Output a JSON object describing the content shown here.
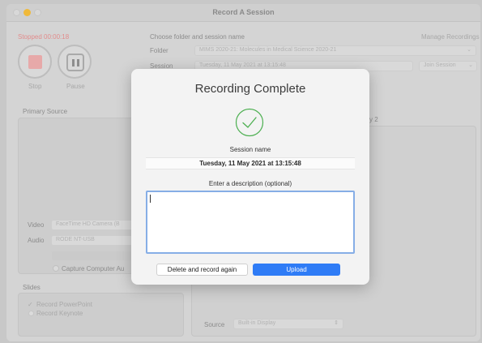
{
  "window": {
    "title": "Record A Session"
  },
  "recorder": {
    "status": "Stopped 00:00:18",
    "stop_label": "Stop",
    "pause_label": "Pause"
  },
  "session_setup": {
    "heading": "Choose folder and session name",
    "manage_link": "Manage Recordings",
    "folder_label": "Folder",
    "folder_value": "MIMS 2020-21: Molecules in Medical Science 2020-21",
    "session_label": "Session",
    "session_value": "Tuesday, 11 May 2021 at 13:15:48",
    "join_session": "Join Session"
  },
  "primary_source": {
    "heading": "Primary Source",
    "video_label": "Video",
    "video_value": "FaceTime HD Camera (B",
    "audio_label": "Audio",
    "audio_value": "RODE NT-USB",
    "capture_audio": "Capture Computer Au"
  },
  "secondary": {
    "tab_suffix": "y 2",
    "source_label": "Source",
    "source_value": "Built-in Display"
  },
  "slides": {
    "heading": "Slides",
    "record_powerpoint": "Record PowerPoint",
    "record_keynote": "Record Keynote"
  },
  "dialog": {
    "title": "Recording Complete",
    "session_name_label": "Session name",
    "session_name_value": "Tuesday, 11 May 2021 at 13:15:48",
    "description_label": "Enter a description (optional)",
    "description_value": "",
    "delete_button": "Delete and record again",
    "upload_button": "Upload"
  },
  "colors": {
    "accent": "#2f7cf6",
    "focus_ring": "#86aee6",
    "success": "#4caf50",
    "stopped_status": "#e28c8c"
  }
}
